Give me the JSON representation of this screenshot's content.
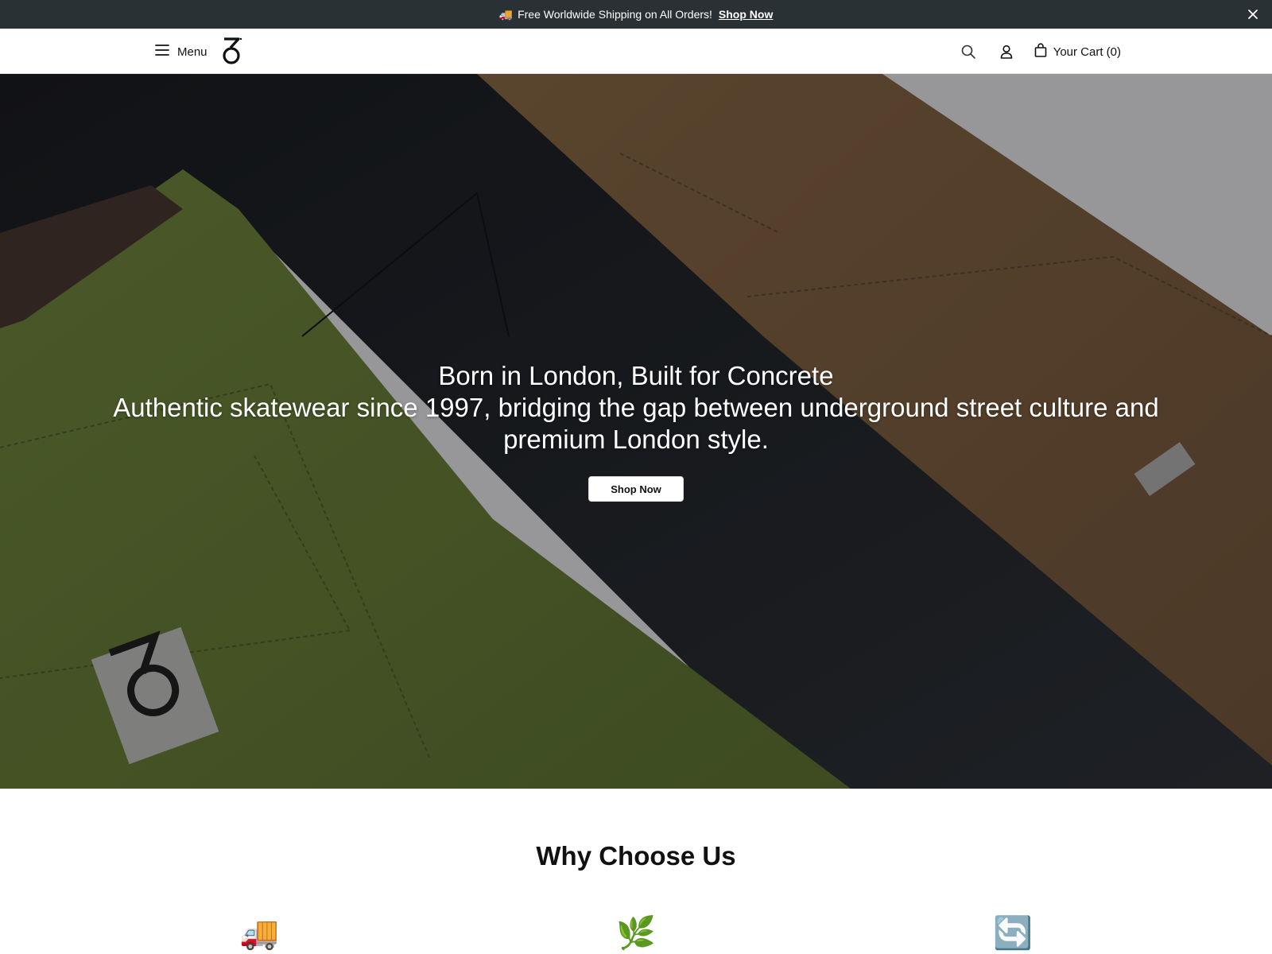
{
  "announcement": {
    "icon": "truck-icon",
    "message": "Free Worldwide Shipping on All Orders!",
    "link_label": "Shop Now",
    "close_icon": "close-icon"
  },
  "header": {
    "menu_label": "Menu",
    "cart_label": "Your Cart (0)",
    "icons": [
      "menu-icon",
      "logo",
      "search-icon",
      "account-icon",
      "bag-icon"
    ]
  },
  "hero": {
    "headline": "Born in London, Built for Concrete",
    "subheadline": "Authentic skatewear since 1997, bridging the gap between underground street culture and premium London style.",
    "cta_label": "Shop Now"
  },
  "why": {
    "title": "Why Choose Us",
    "features": [
      {
        "icon": "🚚"
      },
      {
        "icon": "🌿"
      },
      {
        "icon": "🔄"
      }
    ]
  },
  "colors": {
    "announcement_bg": "#2a3135",
    "pants_green": "#55652e",
    "pants_black": "#1e2024",
    "pants_brown": "#6b5137"
  }
}
